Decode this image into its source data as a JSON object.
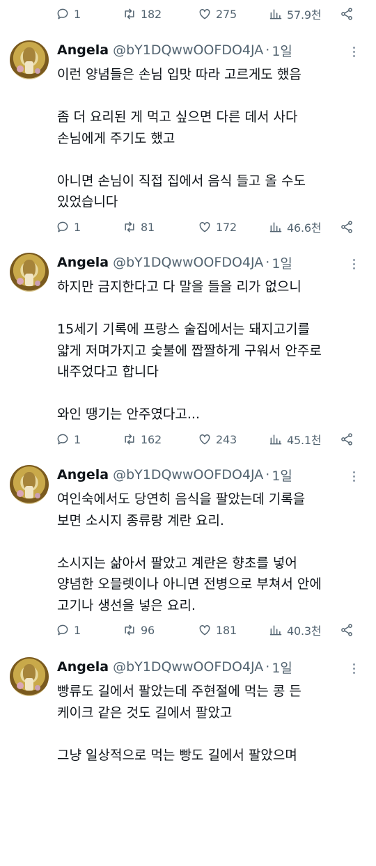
{
  "top_actions": {
    "reply": "1",
    "retweet": "182",
    "like": "275",
    "views": "57.9천"
  },
  "tweets": [
    {
      "name": "Angela",
      "handle": "@bY1DQwwOOFDO4JA",
      "sep": "·",
      "time": "1일",
      "paragraphs": [
        [
          "이런 양념들은 손님 입맛 따라 고르게도 했음"
        ],
        [
          "좀 더 요리된 게 먹고 싶으면 다른 데서 사다",
          "손님에게 주기도 했고"
        ],
        [
          "아니면 손님이 직접 집에서 음식 들고 올 수도",
          "있었습니다"
        ]
      ],
      "actions": {
        "reply": "1",
        "retweet": "81",
        "like": "172",
        "views": "46.6천"
      }
    },
    {
      "name": "Angela",
      "handle": "@bY1DQwwOOFDO4JA",
      "sep": "·",
      "time": "1일",
      "paragraphs": [
        [
          "하지만 금지한다고 다 말을 들을 리가 없으니"
        ],
        [
          "15세기 기록에 프랑스 술집에서는 돼지고기를",
          "얇게 저며가지고 숯불에 짭짤하게 구워서 안주로",
          "내주었다고 합니다"
        ],
        [
          "와인 땡기는 안주였다고..."
        ]
      ],
      "actions": {
        "reply": "1",
        "retweet": "162",
        "like": "243",
        "views": "45.1천"
      }
    },
    {
      "name": "Angela",
      "handle": "@bY1DQwwOOFDO4JA",
      "sep": "·",
      "time": "1일",
      "paragraphs": [
        [
          "여인숙에서도 당연히 음식을 팔았는데 기록을",
          "보면 소시지 종류랑 계란 요리."
        ],
        [
          "소시지는 삶아서 팔았고 계란은 향초를 넣어",
          "양념한 오믈렛이나 아니면 전병으로 부쳐서 안에",
          "고기나 생선을 넣은 요리."
        ]
      ],
      "actions": {
        "reply": "1",
        "retweet": "96",
        "like": "181",
        "views": "40.3천"
      }
    },
    {
      "name": "Angela",
      "handle": "@bY1DQwwOOFDO4JA",
      "sep": "·",
      "time": "1일",
      "paragraphs": [
        [
          "빵류도 길에서 팔았는데 주현절에 먹는 콩 든",
          "케이크 같은 것도 길에서 팔았고"
        ],
        [
          "그냥 일상적으로 먹는 빵도 길에서 팔았으며"
        ]
      ],
      "actions": null
    }
  ]
}
